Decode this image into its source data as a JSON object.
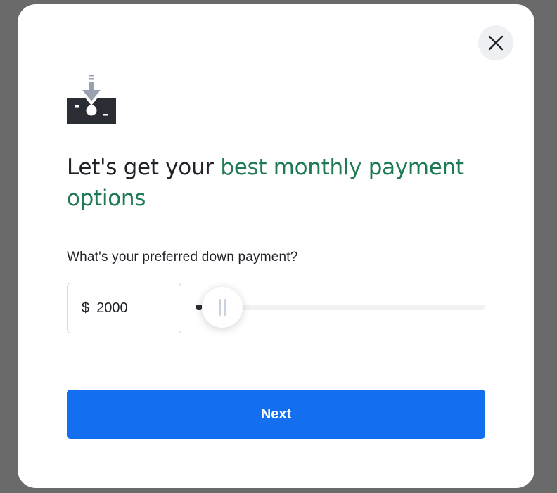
{
  "dialog": {
    "headline_plain": "Let's get your ",
    "headline_accent": "best monthly payment options",
    "question": "What's your preferred down payment?",
    "currency_symbol": "$",
    "down_payment_value": "2000",
    "slider_level_fraction": 0.02,
    "next_label": "Next",
    "icons": {
      "close": "close-icon",
      "hero": "money-deposit-icon",
      "thumb": "slider-grip-icon"
    },
    "colors": {
      "accent": "#1e7a52",
      "primary_button": "#136ff0",
      "text": "#1f2328"
    }
  }
}
